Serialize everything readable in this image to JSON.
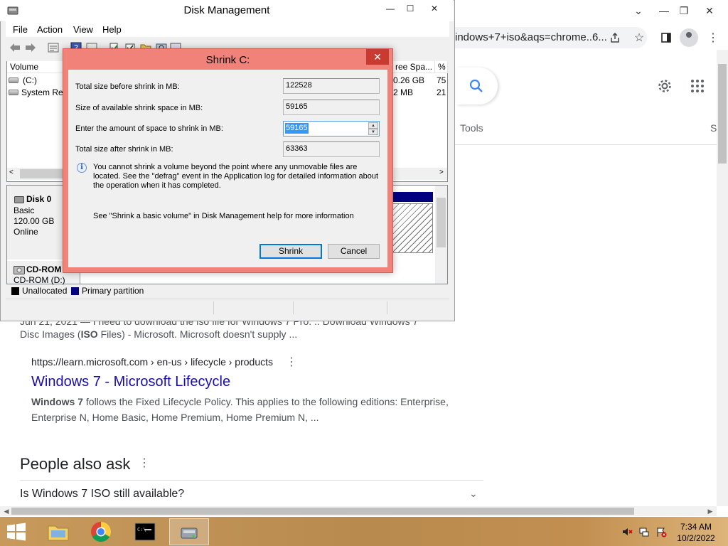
{
  "chrome": {
    "omnibox_text": "indows+7+iso&aqs=chrome..6...",
    "tools_label": "Tools",
    "partial_tab_label": "S"
  },
  "search_results": {
    "partial_line": "Jun 21, 2021 — I need to download the iso file for Windows 7 Pro. .. Download Windows 7",
    "snippet0_prefix": "Disc Images (",
    "snippet0_bold": "ISO",
    "snippet0_suffix": " Files) - Microsoft. Microsoft doesn't supply ...",
    "url": "https://learn.microsoft.com › en-us › lifecycle › products",
    "title": "Windows 7 - Microsoft Lifecycle",
    "snippet_bold": "Windows 7",
    "snippet_rest": " follows the Fixed Lifecycle Policy. This applies to the following editions: Enterprise, Enterprise N, Home Basic, Home Premium, Home Premium N, ...",
    "paa_title": "People also ask",
    "paa_question": "Is Windows 7 ISO still available?"
  },
  "disk_mgmt": {
    "title": "Disk Management",
    "menu": [
      "File",
      "Action",
      "View",
      "Help"
    ],
    "columns": [
      "Volume",
      "ree Spa...",
      "% F"
    ],
    "rows": [
      {
        "volume": "(C:)",
        "free": "0.26 GB",
        "pct": "75"
      },
      {
        "volume": "System Res",
        "free": "2 MB",
        "pct": "21"
      }
    ],
    "disk0": {
      "name": "Disk 0",
      "type": "Basic",
      "size": "120.00 GB",
      "status": "Online"
    },
    "cdrom": {
      "name": "CD-ROM 0",
      "drive": "CD-ROM (D:)"
    },
    "legend": {
      "unallocated": "Unallocated",
      "primary": "Primary partition"
    }
  },
  "shrink": {
    "title": "Shrink C:",
    "close_glyph": "✕",
    "labels": {
      "total_before": "Total size before shrink in MB:",
      "available": "Size of available shrink space in MB:",
      "enter_amount": "Enter the amount of space to shrink in MB:",
      "total_after": "Total size after shrink in MB:"
    },
    "values": {
      "total_before": "122528",
      "available": "59165",
      "enter_amount": "59165",
      "total_after": "63363"
    },
    "info_text": "You cannot shrink a volume beyond the point where any unmovable files are located. See the \"defrag\" event in the Application log for detailed information about the operation when it has completed.",
    "help_text": "See \"Shrink a basic volume\" in Disk Management help for more information",
    "shrink_button": "Shrink",
    "cancel_button": "Cancel"
  },
  "taskbar": {
    "time": "7:34 AM",
    "date": "10/2/2022"
  },
  "colors": {
    "dialog_border": "#f0827a",
    "primary_partition": "#000080",
    "link": "#1a0dab"
  }
}
